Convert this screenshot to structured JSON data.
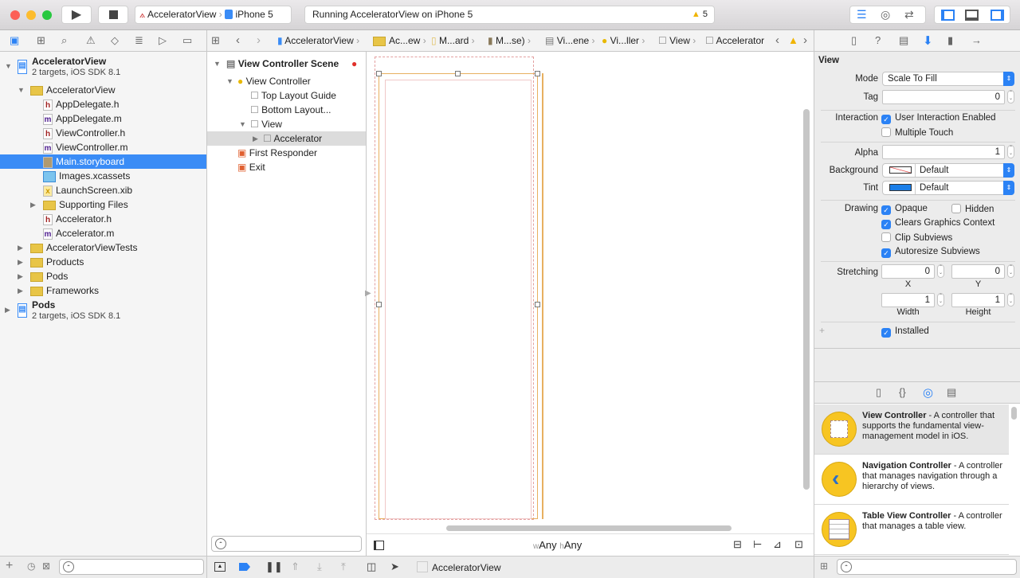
{
  "toolbar": {
    "scheme": "AcceleratorView",
    "device": "iPhone 5",
    "status": "Running AcceleratorView on iPhone 5",
    "warning_count": "5",
    "icons": [
      "play-icon",
      "stop-icon",
      "standard-editor-icon",
      "assistant-editor-icon",
      "version-editor-icon",
      "navigator-toggle-icon",
      "debug-area-toggle-icon",
      "utilities-toggle-icon"
    ]
  },
  "navigator": {
    "tabs": [
      "folder-icon",
      "hierarchy-icon",
      "search-icon",
      "warning-icon",
      "test-icon",
      "debug-icon",
      "breakpoint-icon",
      "report-icon"
    ],
    "items": [
      {
        "label": "AcceleratorView",
        "sub": "2 targets, iOS SDK 8.1",
        "kind": "project",
        "open": true
      },
      {
        "label": "AcceleratorView",
        "kind": "folder",
        "open": true
      },
      {
        "label": "AppDelegate.h",
        "kind": "h"
      },
      {
        "label": "AppDelegate.m",
        "kind": "m"
      },
      {
        "label": "ViewController.h",
        "kind": "h"
      },
      {
        "label": "ViewController.m",
        "kind": "m"
      },
      {
        "label": "Main.storyboard",
        "kind": "storyboard",
        "selected": true
      },
      {
        "label": "Images.xcassets",
        "kind": "assets"
      },
      {
        "label": "LaunchScreen.xib",
        "kind": "xib"
      },
      {
        "label": "Supporting Files",
        "kind": "folder"
      },
      {
        "label": "Accelerator.h",
        "kind": "h"
      },
      {
        "label": "Accelerator.m",
        "kind": "m"
      },
      {
        "label": "AcceleratorViewTests",
        "kind": "folder"
      },
      {
        "label": "Products",
        "kind": "folder"
      },
      {
        "label": "Pods",
        "kind": "folder"
      },
      {
        "label": "Frameworks",
        "kind": "folder"
      },
      {
        "label": "Pods",
        "sub": "2 targets, iOS SDK 8.1",
        "kind": "project"
      }
    ]
  },
  "jumpbar": [
    "AcceleratorView",
    "Ac...ew",
    "M...ard",
    "M...se)",
    "Vi...ene",
    "Vi...ller",
    "View",
    "Accelerator"
  ],
  "outline": {
    "items": [
      "View Controller Scene",
      "View Controller",
      "Top Layout Guide",
      "Bottom Layout...",
      "View",
      "Accelerator",
      "First Responder",
      "Exit"
    ]
  },
  "canvas": {
    "size_class": {
      "w": "w",
      "w_val": "Any",
      "h": "h",
      "h_val": "Any"
    }
  },
  "inspector": {
    "section": "View",
    "mode_label": "Mode",
    "mode": "Scale To Fill",
    "tag_label": "Tag",
    "tag": "0",
    "interaction_label": "Interaction",
    "user_interaction": "User Interaction Enabled",
    "multiple_touch": "Multiple Touch",
    "alpha_label": "Alpha",
    "alpha": "1",
    "background_label": "Background",
    "background": "Default",
    "tint_label": "Tint",
    "tint": "Default",
    "tint_color": "#1a7ee8",
    "drawing_label": "Drawing",
    "opaque": "Opaque",
    "hidden": "Hidden",
    "clears": "Clears Graphics Context",
    "clip": "Clip Subviews",
    "autoresize": "Autoresize Subviews",
    "stretching_label": "Stretching",
    "sx": "0",
    "sy": "0",
    "sw": "1",
    "sh": "1",
    "x_label": "X",
    "y_label": "Y",
    "w_label": "Width",
    "h_label": "Height",
    "installed": "Installed"
  },
  "library": {
    "items": [
      {
        "title": "View Controller",
        "desc": " - A controller that supports the fundamental view-management model in iOS."
      },
      {
        "title": "Navigation Controller",
        "desc": " - A controller that manages navigation through a hierarchy of views."
      },
      {
        "title": "Table View Controller",
        "desc": " - A controller that manages a table view."
      }
    ]
  },
  "debugbar": {
    "process": "AcceleratorView"
  },
  "colors": {
    "accent": "#2b82f5",
    "selection": "#3a8cf6"
  }
}
